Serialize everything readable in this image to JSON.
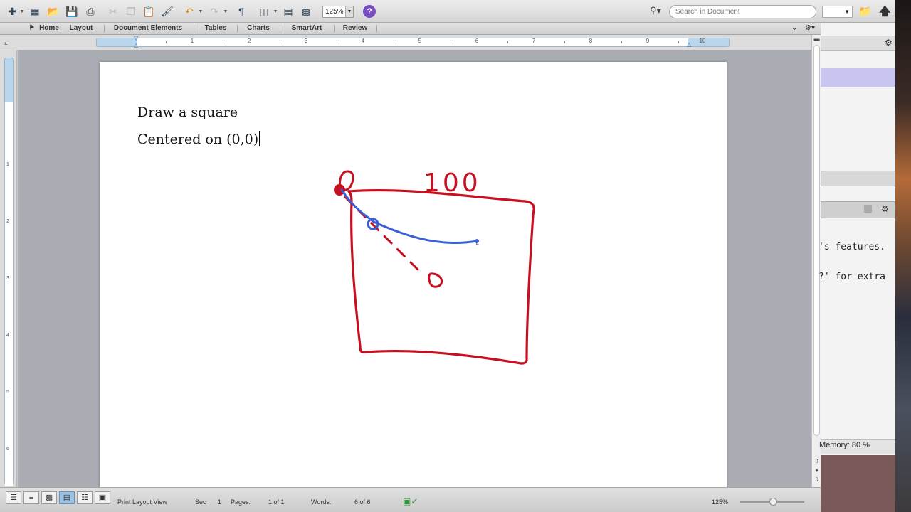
{
  "toolbar": {
    "zoom_value": "125%",
    "search_placeholder": "Search in Document"
  },
  "ribbon": {
    "tabs": [
      "Home",
      "Layout",
      "Document Elements",
      "Tables",
      "Charts",
      "SmartArt",
      "Review"
    ]
  },
  "ruler": {
    "numbers": [
      "1",
      "2",
      "3",
      "4",
      "5",
      "6",
      "7",
      "8",
      "9",
      "10"
    ],
    "vertical_numbers": [
      "1",
      "2",
      "3",
      "4",
      "5",
      "6"
    ]
  },
  "document": {
    "lines": [
      "Draw a square",
      "Centered on (0,0)"
    ],
    "annotation_text": "100",
    "ink_colors": {
      "red": "#c6101f",
      "blue": "#3b5fd6"
    }
  },
  "statusbar": {
    "view_label": "Print Layout View",
    "sec_label": "Sec",
    "sec_value": "1",
    "pages_label": "Pages:",
    "pages_value": "1 of 1",
    "words_label": "Words:",
    "words_value": "6 of 6",
    "zoom_value": "125%"
  },
  "background_app": {
    "console_lines": [
      "'s features.",
      "?' for extra"
    ],
    "memory_text": "Memory:  80 %"
  }
}
